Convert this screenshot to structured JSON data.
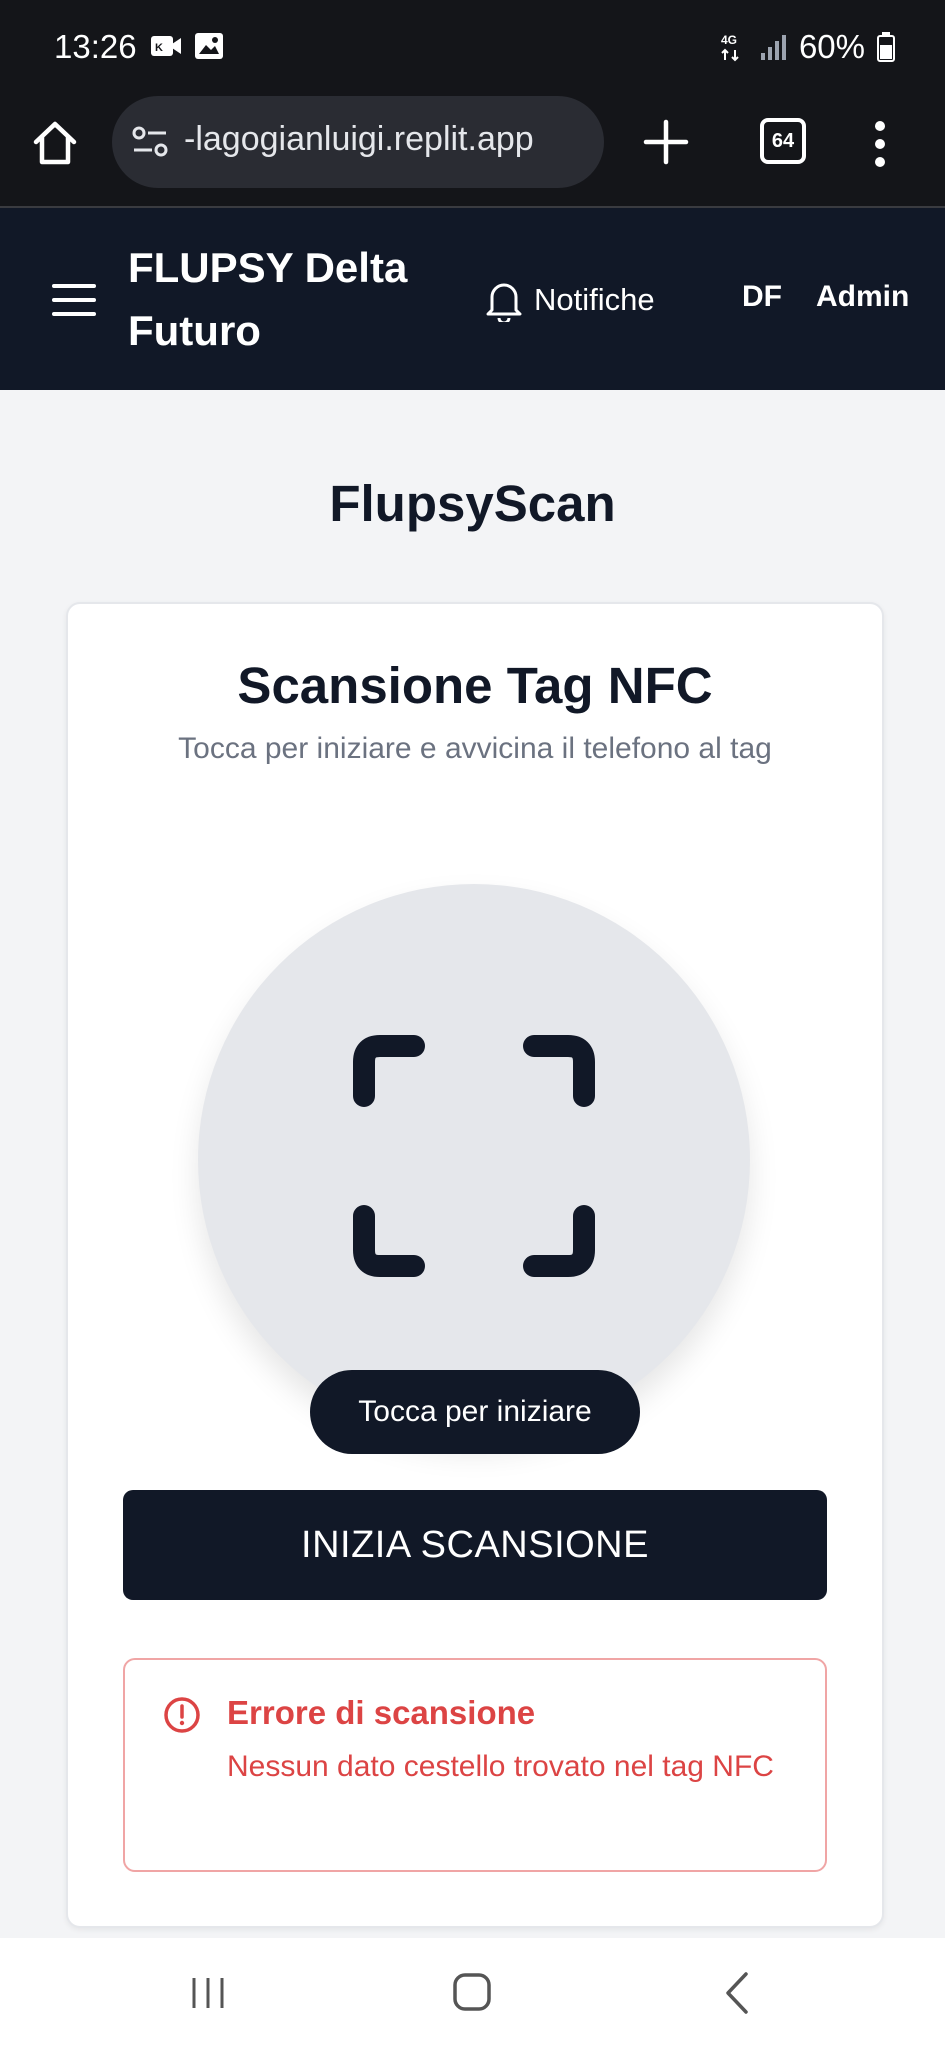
{
  "status_bar": {
    "time": "13:26",
    "network": "4G",
    "battery": "60%",
    "icons": [
      "notification-app-icon",
      "image-icon",
      "signal-icon",
      "battery-icon"
    ]
  },
  "browser": {
    "url": "-lagogianluigi.replit.app",
    "tab_count": "64",
    "icons": [
      "home-icon",
      "site-info-icon",
      "plus-icon",
      "tabs-icon",
      "more-vert-icon"
    ]
  },
  "header": {
    "title": "FLUPSY Delta Futuro",
    "notifications_label": "Notifiche",
    "user_initials": "DF",
    "user_role": "Admin",
    "icons": [
      "hamburger-menu-icon",
      "bell-icon"
    ]
  },
  "page": {
    "title": "FlupsyScan"
  },
  "scan_card": {
    "title": "Scansione Tag NFC",
    "subtitle": "Tocca per iniziare e avvicina il telefono al tag",
    "tap_hint": "Tocca per iniziare",
    "scan_button": "INIZIA SCANSIONE",
    "icons": [
      "scan-frame-icon"
    ]
  },
  "error": {
    "title": "Errore di scansione",
    "message": "Nessun dato cestello trovato nel tag NFC",
    "icons": [
      "alert-circle-icon"
    ]
  },
  "nav_bar": {
    "icons": [
      "recents-icon",
      "home-nav-icon",
      "back-icon"
    ]
  },
  "colors": {
    "header_bg": "#111827",
    "system_bar_bg": "#141519",
    "page_bg": "#f3f4f6",
    "error": "#dc4444",
    "error_border": "#f0a5a5",
    "scan_circle": "#e5e7eb"
  }
}
